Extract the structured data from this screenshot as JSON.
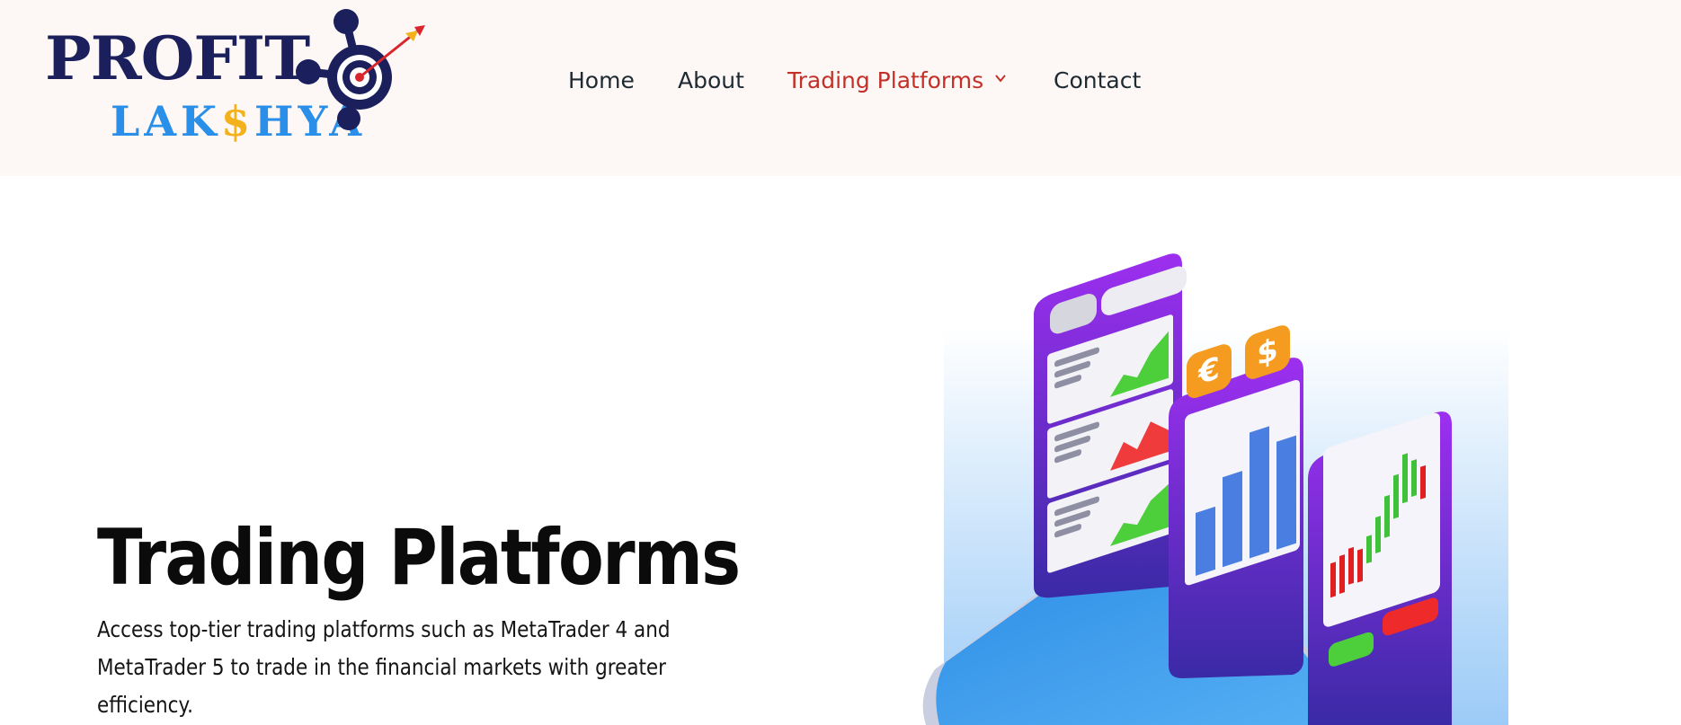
{
  "logo": {
    "word1": "PROFIT",
    "word2_part1": "LAK",
    "word2_dollar": "$",
    "word2_part2": "HYA"
  },
  "nav": {
    "items": [
      {
        "label": "Home"
      },
      {
        "label": "About"
      },
      {
        "label": "Trading Platforms",
        "active": true
      },
      {
        "label": "Contact"
      }
    ]
  },
  "hero": {
    "title": "Trading Platforms",
    "description": "Access top-tier trading platforms such as MetaTrader 4 and MetaTrader 5 to trade in the financial markets with greater efficiency."
  },
  "illustration": {
    "currency_euro": "€",
    "currency_dollar": "$"
  },
  "colors": {
    "header_bg": "#fdf7f6",
    "nav_text": "#1e2a32",
    "nav_active": "#c23028",
    "logo_navy": "#1b1f5c",
    "logo_blue": "#2a8fe8",
    "logo_gold": "#f3b21b",
    "purple": "#6a2bd8",
    "orange": "#f59b1f"
  }
}
